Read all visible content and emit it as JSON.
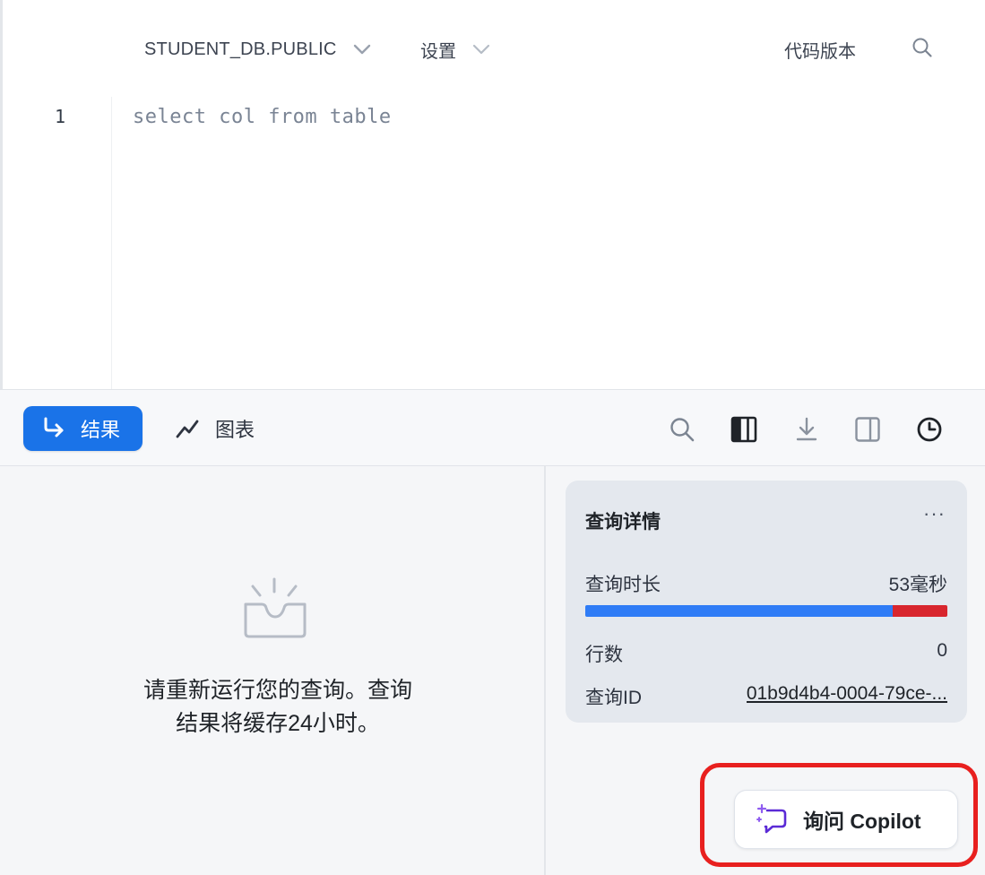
{
  "toolbar": {
    "database": "STUDENT_DB.PUBLIC",
    "settings": "设置",
    "code_version": "代码版本"
  },
  "editor": {
    "line_number": "1",
    "code": "select col from table"
  },
  "result_bar": {
    "results_label": "结果",
    "chart_label": "图表"
  },
  "empty_state": {
    "message_line1": "请重新运行您的查询。查询",
    "message_line2": "结果将缓存24小时。"
  },
  "query_details": {
    "title": "查询详情",
    "more": "···",
    "duration_label": "查询时长",
    "duration_value": "53毫秒",
    "duration_bar": {
      "primary_fraction": 0.85,
      "secondary_fraction": 0.15
    },
    "rows_label": "行数",
    "rows_value": "0",
    "query_id_label": "查询ID",
    "query_id_value": "01b9d4b4-0004-79ce-..."
  },
  "copilot": {
    "label": "询问 Copilot"
  },
  "colors": {
    "accent": "#1a73e8",
    "bar_primary": "#2f7cf6",
    "bar_secondary": "#d8262e",
    "highlight": "#e8201f"
  }
}
